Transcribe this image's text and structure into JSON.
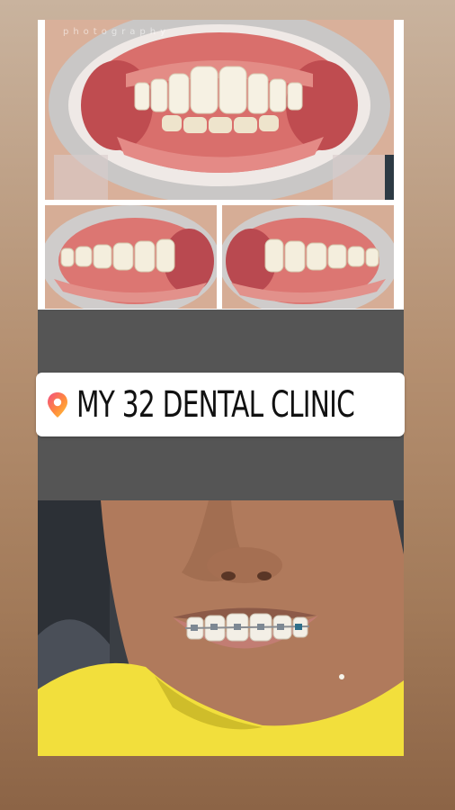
{
  "story": {
    "watermark": "photography",
    "location_sticker": {
      "icon": "location-pin-icon",
      "text": "MY 32 DENTAL CLINIC",
      "pin_gradient": [
        "#f24e84",
        "#ff8a3d",
        "#ffc837"
      ]
    },
    "photos": [
      {
        "name": "front-teeth-view"
      },
      {
        "name": "left-side-teeth-view"
      },
      {
        "name": "right-side-teeth-view"
      },
      {
        "name": "smile-with-braces"
      }
    ],
    "colors": {
      "band": "#555555",
      "background": "#b48f70"
    }
  }
}
